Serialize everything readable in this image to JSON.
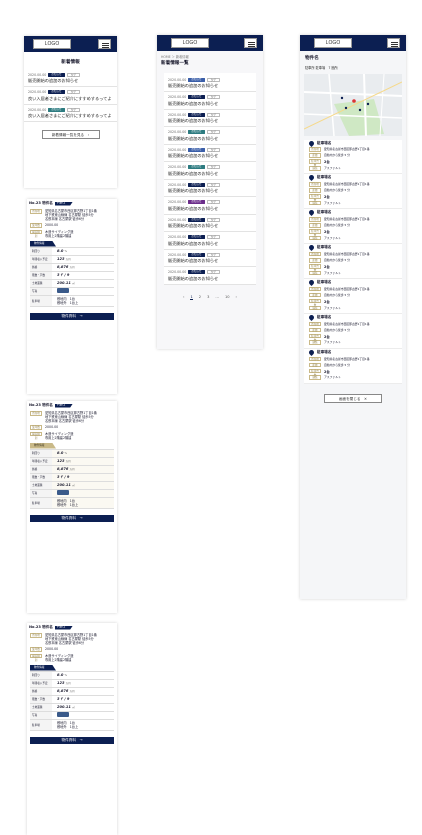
{
  "header": {
    "logo": "LOGO"
  },
  "news_panel": {
    "heading": "新着情報",
    "items": [
      {
        "date": "2020.00.00",
        "tag": "お知らせ",
        "tag2": "タグ",
        "tag_color": "#0c1f52",
        "title": "販売開始の追加のお知らせ"
      },
      {
        "date": "2020.00.00",
        "tag": "お知らせ",
        "tag2": "タグ",
        "tag_color": "#0c1f52",
        "title": "良い入居者さまにご紹介にすすめするってよ"
      },
      {
        "date": "2020.00.00",
        "tag": "お知らせ",
        "tag2": "タグ",
        "tag_color": "#2d7b80",
        "title": "良い入居者さまにご紹介にすすめするってよ"
      }
    ],
    "more_button": "新着情報一覧を見る　›"
  },
  "property_cards": [
    {
      "no": "No.23 物件名",
      "badge": "TYPE A",
      "address_label": "所在地",
      "address": "愛知県名古屋市西区那古野1丁目1番\n地下鉄東山線線 名古屋駅 徒歩5分\n名鉄本線 名古屋駅 徒歩6分",
      "built_label": "築年数",
      "built": "2000.00",
      "structure_label": "構造種別",
      "structure": "木造サイディング造\n専用上2階建2階建",
      "spec_tab": "物件情報",
      "specs": [
        {
          "k": "利回り",
          "v": "8.0",
          "u": "%"
        },
        {
          "k": "年間収入予定",
          "v": "123",
          "u": "万円"
        },
        {
          "k": "価格",
          "v": "8,876",
          "u": "万円"
        },
        {
          "k": "階数・戸数",
          "v": "3ｆ / 9",
          "u": ""
        },
        {
          "k": "土地面積",
          "v": "200.11",
          "u": "㎡"
        },
        {
          "k": "写真",
          "v": "",
          "u": ""
        },
        {
          "k": "駐車場",
          "v": "敷地内　1台\n敷地外　1台上",
          "u": ""
        }
      ],
      "detail_button": "物件資料　→"
    },
    {
      "no": "No.23 物件名",
      "badge": "TYPE A",
      "address_label": "所在地",
      "address": "愛知県名古屋市西区那古野1丁目1番\n地下鉄東山線線 名古屋駅 徒歩5分\n名鉄本線 名古屋駅 徒歩6分",
      "built_label": "築年数",
      "built": "2000.00",
      "structure_label": "構造種別",
      "structure": "木造サイディング造\n専用上2階建2階建",
      "spec_tab": "物件情報",
      "specs": [
        {
          "k": "利回り",
          "v": "8.0",
          "u": "%"
        },
        {
          "k": "年間収入予定",
          "v": "123",
          "u": "万円"
        },
        {
          "k": "価格",
          "v": "8,876",
          "u": "万円"
        },
        {
          "k": "階数・戸数",
          "v": "3ｆ / 9",
          "u": ""
        },
        {
          "k": "土地面積",
          "v": "200.11",
          "u": "㎡"
        },
        {
          "k": "写真",
          "v": "",
          "u": ""
        },
        {
          "k": "駐車場",
          "v": "敷地内　1台\n敷地外　1台上",
          "u": ""
        }
      ],
      "detail_button": "物件資料　→"
    },
    {
      "no": "No.23 物件名",
      "badge": "TYPE A",
      "address_label": "所在地",
      "address": "愛知県名古屋市西区那古野1丁目1番\n地下鉄東山線線 名古屋駅 徒歩5分\n名鉄本線 名古屋駅 徒歩6分",
      "built_label": "築年数",
      "built": "2000.00",
      "structure_label": "構造種別",
      "structure": "木造サイディング造\n専用上2階建2階建",
      "spec_tab": "物件情報",
      "specs": [
        {
          "k": "利回り",
          "v": "8.0",
          "u": "%"
        },
        {
          "k": "年間収入予定",
          "v": "123",
          "u": "万円"
        },
        {
          "k": "価格",
          "v": "8,876",
          "u": "万円"
        },
        {
          "k": "階数・戸数",
          "v": "3ｆ / 9",
          "u": ""
        },
        {
          "k": "土地面積",
          "v": "200.11",
          "u": "㎡"
        },
        {
          "k": "写真",
          "v": "",
          "u": ""
        },
        {
          "k": "駐車場",
          "v": "敷地内　1台\n敷地外　1台上",
          "u": ""
        }
      ],
      "detail_button": "物件資料　→"
    }
  ],
  "news_list_page": {
    "breadcrumb": "HOME ＞ 新着情報",
    "heading": "新着情報一覧",
    "items": [
      {
        "date": "2020.00.00",
        "tag": "お知らせ",
        "tag2": "タグ",
        "tag_color": "#3a5ea8",
        "title": "販売開始の追加のお知らせ"
      },
      {
        "date": "2020.00.00",
        "tag": "お知らせ",
        "tag2": "タグ",
        "tag_color": "#0c1f52",
        "title": "販売開始の追加のお知らせ"
      },
      {
        "date": "2020.00.00",
        "tag": "お知らせ",
        "tag2": "タグ",
        "tag_color": "#0c1f52",
        "title": "販売開始の追加のお知らせ"
      },
      {
        "date": "2020.00.00",
        "tag": "お知らせ",
        "tag2": "タグ",
        "tag_color": "#2d7b80",
        "title": "販売開始の追加のお知らせ"
      },
      {
        "date": "2020.00.00",
        "tag": "お知らせ",
        "tag2": "タグ",
        "tag_color": "#3a5ea8",
        "title": "販売開始の追加のお知らせ"
      },
      {
        "date": "2020.00.00",
        "tag": "お知らせ",
        "tag2": "タグ",
        "tag_color": "#2d7b80",
        "title": "販売開始の追加のお知らせ"
      },
      {
        "date": "2020.00.00",
        "tag": "お知らせ",
        "tag2": "タグ",
        "tag_color": "#0c1f52",
        "title": "販売開始の追加のお知らせ"
      },
      {
        "date": "2020.00.00",
        "tag": "お知らせ",
        "tag2": "タグ",
        "tag_color": "#6b2d8a",
        "title": "販売開始の追加のお知らせ"
      },
      {
        "date": "2020.00.00",
        "tag": "お知らせ",
        "tag2": "タグ",
        "tag_color": "#0c1f52",
        "title": "販売開始の追加のお知らせ"
      },
      {
        "date": "2020.00.00",
        "tag": "お知らせ",
        "tag2": "タグ",
        "tag_color": "#0c1f52",
        "title": "販売開始の追加のお知らせ"
      },
      {
        "date": "2020.00.00",
        "tag": "お知らせ",
        "tag2": "タグ",
        "tag_color": "#0c1f52",
        "title": "販売開始の追加のお知らせ"
      },
      {
        "date": "2020.00.00",
        "tag": "お知らせ",
        "tag2": "タグ",
        "tag_color": "#0c1f52",
        "title": "販売開始の追加のお知らせ"
      }
    ],
    "pager": {
      "prev": "‹",
      "pages": [
        "1",
        "2",
        "3"
      ],
      "ellipsis": "…",
      "last": "10",
      "next": "›"
    }
  },
  "parking_page": {
    "title": "物件名",
    "subtitle": "駐車所 駐車場　7 箇所",
    "lots": [
      {
        "name": "駐車場名",
        "addr_label": "所在地",
        "addr": "愛知県名古屋市西区那古野1丁目1番",
        "dist_label": "距離",
        "dist": "自動内から徒歩 5 分",
        "count_label": "駐車台数",
        "count": "2台",
        "surface_label": "舗装",
        "surface": "アスファルト"
      },
      {
        "name": "駐車場名",
        "addr_label": "所在地",
        "addr": "愛知県名古屋市西区那古野1丁目1番",
        "dist_label": "距離",
        "dist": "自動内から徒歩 5 分",
        "count_label": "駐車台数",
        "count": "2台",
        "surface_label": "舗装",
        "surface": "アスファルト"
      },
      {
        "name": "駐車場名",
        "addr_label": "所在地",
        "addr": "愛知県名古屋市西区那古野1丁目1番",
        "dist_label": "距離",
        "dist": "自動内から徒歩 5 分",
        "count_label": "駐車台数",
        "count": "2台",
        "surface_label": "舗装",
        "surface": "アスファルト"
      },
      {
        "name": "駐車場名",
        "addr_label": "所在地",
        "addr": "愛知県名古屋市西区那古野1丁目1番",
        "dist_label": "距離",
        "dist": "自動内から徒歩 5 分",
        "count_label": "駐車台数",
        "count": "2台",
        "surface_label": "舗装",
        "surface": "アスファルト"
      },
      {
        "name": "駐車場名",
        "addr_label": "所在地",
        "addr": "愛知県名古屋市西区那古野1丁目1番",
        "dist_label": "距離",
        "dist": "自動内から徒歩 5 分",
        "count_label": "駐車台数",
        "count": "2台",
        "surface_label": "舗装",
        "surface": "アスファルト"
      },
      {
        "name": "駐車場名",
        "addr_label": "所在地",
        "addr": "愛知県名古屋市西区那古野1丁目1番",
        "dist_label": "距離",
        "dist": "自動内から徒歩 5 分",
        "count_label": "駐車台数",
        "count": "2台",
        "surface_label": "舗装",
        "surface": "アスファルト"
      },
      {
        "name": "駐車場名",
        "addr_label": "所在地",
        "addr": "愛知県名古屋市西区那古野1丁目1番",
        "dist_label": "距離",
        "dist": "自動内から徒歩 5 分",
        "count_label": "駐車台数",
        "count": "2台",
        "surface_label": "舗装",
        "surface": "アスファルト"
      }
    ],
    "close_button": "画面を閉じる　✕"
  },
  "colors": {
    "navy": "#0c1f52",
    "gold": "#c9b988",
    "map_green": "#cfe8c4"
  }
}
